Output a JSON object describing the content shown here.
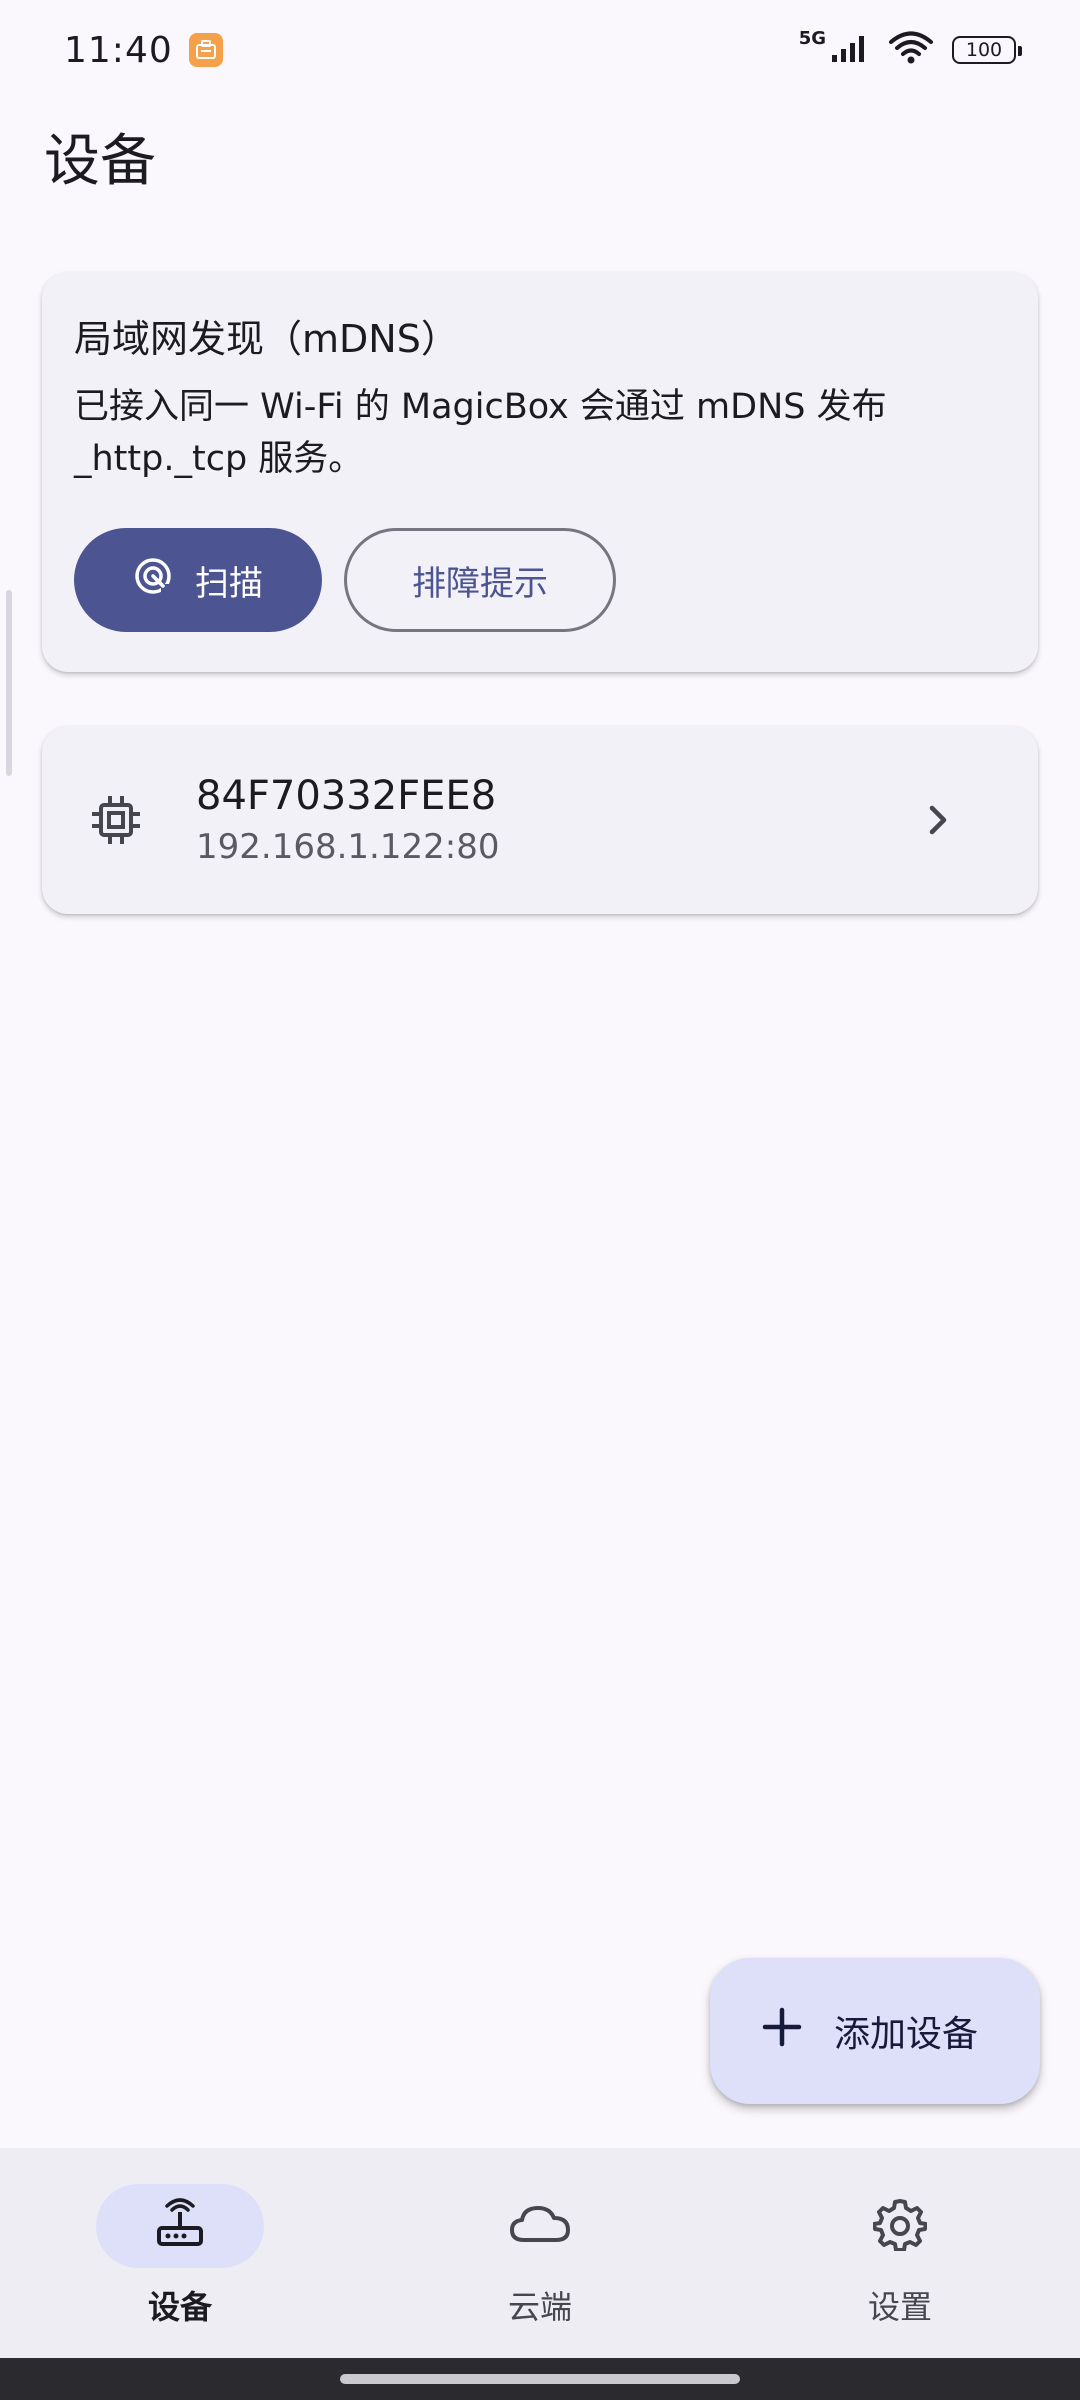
{
  "status_bar": {
    "time": "11:40",
    "network_type": "5G",
    "battery": "100",
    "icons": [
      "app-notification-icon",
      "signal-icon",
      "wifi-icon",
      "battery-icon"
    ]
  },
  "page": {
    "title": "设备"
  },
  "mdns_card": {
    "title": "局域网发现（mDNS）",
    "description": "已接入同一 Wi-Fi 的 MagicBox 会通过 mDNS 发布 _http._tcp 服务。",
    "scan_label": "扫描",
    "tips_label": "排障提示"
  },
  "devices": [
    {
      "name": "84F70332FEE8",
      "address": "192.168.1.122:80",
      "icon": "chip-icon"
    }
  ],
  "fab": {
    "label": "添加设备",
    "icon": "plus-icon"
  },
  "bottom_nav": {
    "items": [
      {
        "label": "设备",
        "icon": "router-icon",
        "active": true
      },
      {
        "label": "云端",
        "icon": "cloud-icon",
        "active": false
      },
      {
        "label": "设置",
        "icon": "gear-icon",
        "active": false
      }
    ]
  },
  "colors": {
    "primary": "#4c5591",
    "primary_container": "#dee0fa",
    "surface": "#fbf8fd",
    "card": "#f3f1f8",
    "nav_bar": "#efedf4"
  }
}
